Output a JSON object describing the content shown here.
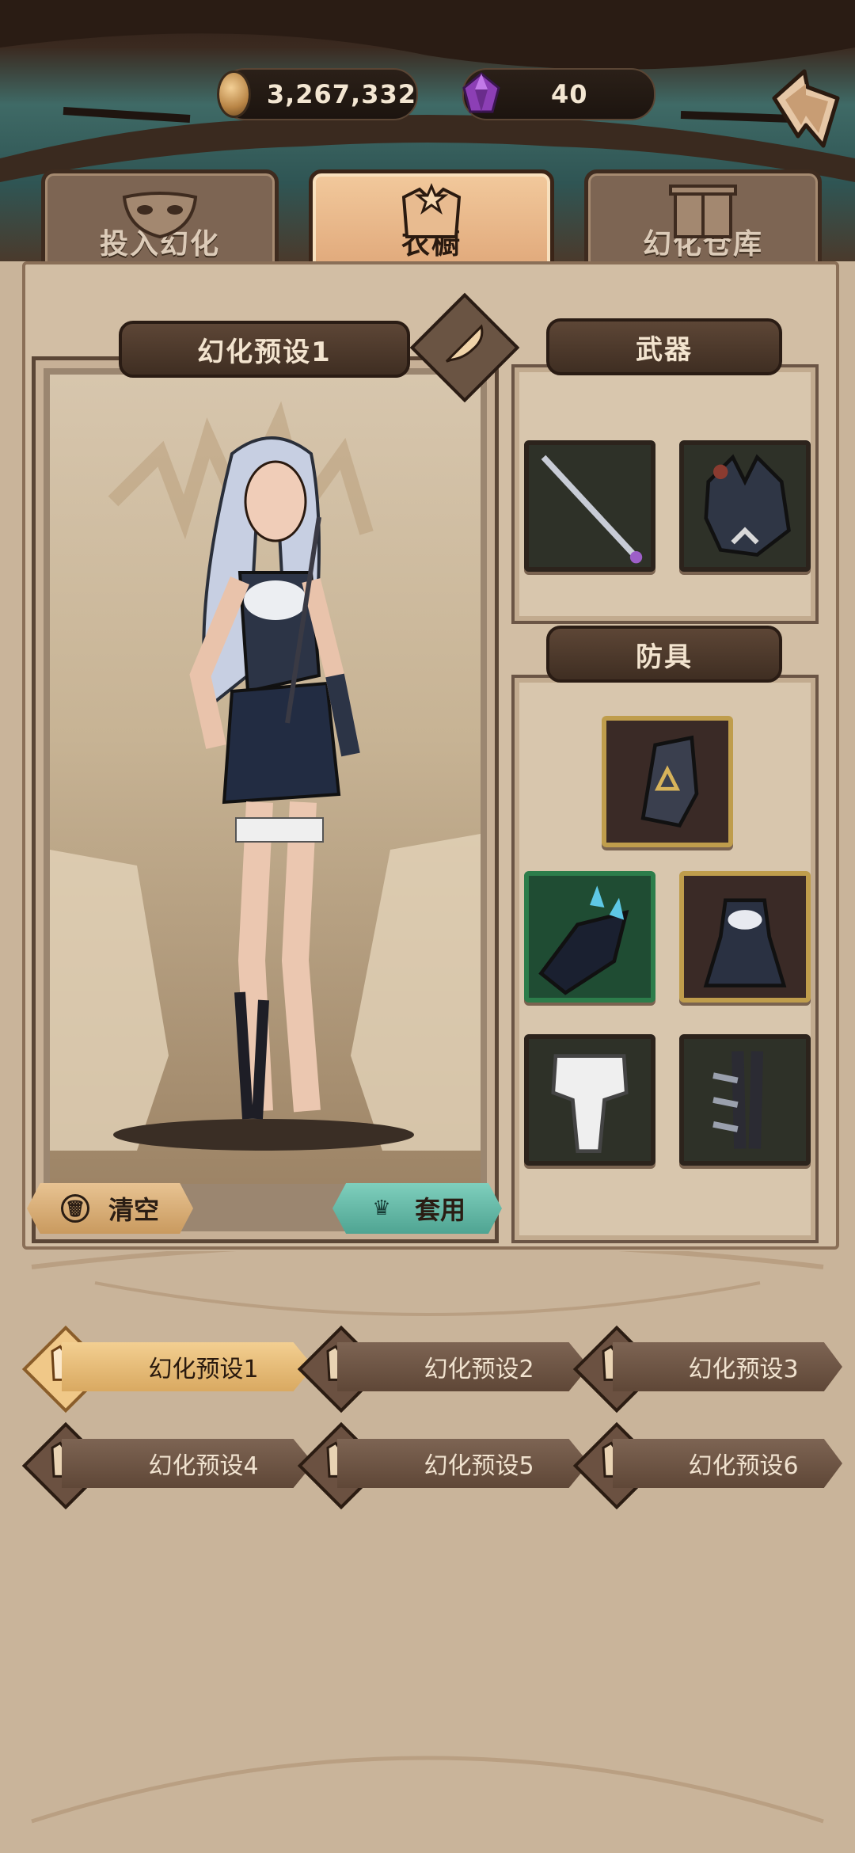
{
  "currency": {
    "gold": "3,267,332",
    "gems": "40"
  },
  "tabs": [
    {
      "label": "投入幻化",
      "active": false
    },
    {
      "label": "衣橱",
      "active": true
    },
    {
      "label": "幻化仓库",
      "active": false
    }
  ],
  "preview": {
    "preset_title": "幻化预设1",
    "clear_label": "清空",
    "apply_label": "套用"
  },
  "weapons": {
    "title": "武器",
    "slots": [
      "staff-icon",
      "wolf-head-icon"
    ]
  },
  "armor": {
    "title": "防具",
    "slots": [
      "gauntlet-armor-icon",
      "crystal-claw-icon",
      "dress-armor-icon",
      "white-pants-icon",
      "bone-leg-icon"
    ]
  },
  "presets": [
    {
      "label": "幻化预设1",
      "active": true
    },
    {
      "label": "幻化预设2",
      "active": false
    },
    {
      "label": "幻化预设3",
      "active": false
    },
    {
      "label": "幻化预设4",
      "active": false
    },
    {
      "label": "幻化预设5",
      "active": false
    },
    {
      "label": "幻化预设6",
      "active": false
    }
  ],
  "colors": {
    "accent_active": "#e8b27e",
    "panel": "#d2bea4",
    "teal_button": "#5fb8a6"
  }
}
